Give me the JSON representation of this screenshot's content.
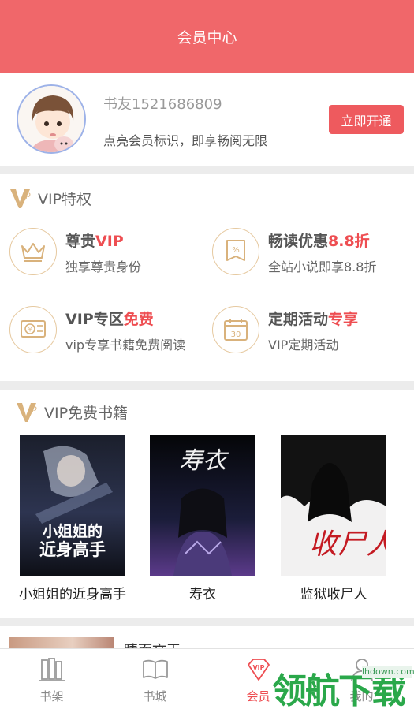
{
  "header": {
    "title": "会员中心"
  },
  "profile": {
    "nickname": "书友1521686809",
    "subtitle": "点亮会员标识，即享畅阅无限",
    "open_button": "立即开通"
  },
  "privileges": {
    "title": "VIP特权",
    "items": [
      {
        "title_main": "尊贵",
        "title_highlight": "VIP",
        "desc": "独享尊贵身份",
        "icon": "crown-icon"
      },
      {
        "title_main": "畅读优惠",
        "title_highlight": "8.8折",
        "desc": "全站小说即享8.8折",
        "icon": "discount-tag-icon"
      },
      {
        "title_main": "VIP专区",
        "title_highlight": "免费",
        "desc": "vip专享书籍免费阅读",
        "icon": "coupon-icon"
      },
      {
        "title_main": "定期活动",
        "title_highlight": "专享",
        "desc": "VIP定期活动",
        "icon": "calendar-icon"
      }
    ],
    "calendar_number": "30"
  },
  "free_books": {
    "title": "VIP免费书籍",
    "items": [
      {
        "title": "小姐姐的近身高手",
        "cover_text_line1": "小姐姐的",
        "cover_text_line2": "近身高手"
      },
      {
        "title": "寿衣",
        "cover_text_line1": "寿衣"
      },
      {
        "title": "监狱收尸人",
        "cover_text_line1": "收尸人"
      }
    ]
  },
  "teaser": {
    "text": "睛而文王"
  },
  "tabbar": {
    "items": [
      {
        "label": "书架",
        "icon": "bookshelf-icon"
      },
      {
        "label": "书城",
        "icon": "open-book-icon"
      },
      {
        "label": "会员",
        "icon": "vip-diamond-icon"
      },
      {
        "label": "我的",
        "icon": "user-icon"
      }
    ],
    "active": "会员"
  },
  "watermark": {
    "text": "领航下载",
    "url": "lhdown.com"
  },
  "colors": {
    "header": "#f0676a",
    "accent": "#ee4e52",
    "gold": "#d9b27c"
  }
}
